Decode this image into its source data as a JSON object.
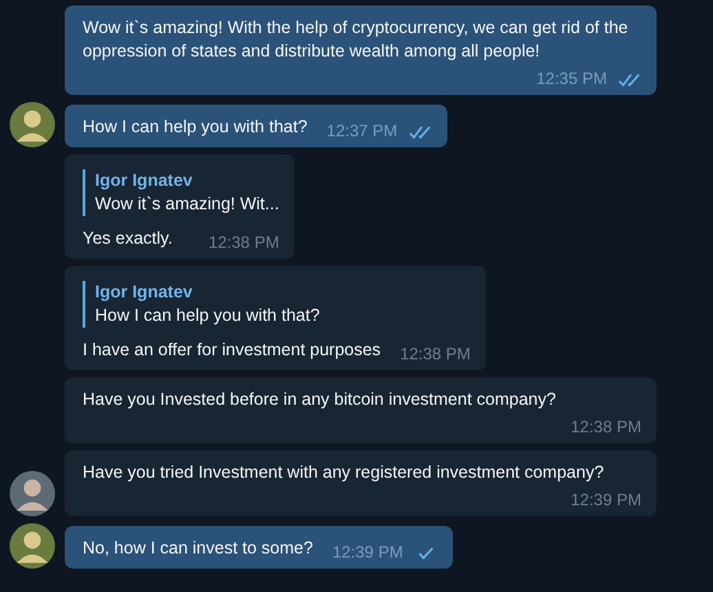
{
  "messages": [
    {
      "outgoing": true,
      "avatar": false,
      "text": "Wow it`s amazing! With the help of cryptocurrency, we can get rid of the oppression of states and distribute wealth among all people!",
      "time": "12:35 PM",
      "read": true
    },
    {
      "outgoing": true,
      "avatar": true,
      "text": "How I can help you with that?",
      "time": "12:37 PM",
      "read": true
    },
    {
      "outgoing": false,
      "avatar": false,
      "reply": {
        "author": "Igor Ignatev",
        "text": "Wow it`s amazing! Wit..."
      },
      "text": "Yes exactly.",
      "time": "12:38 PM"
    },
    {
      "outgoing": false,
      "avatar": false,
      "reply": {
        "author": "Igor Ignatev",
        "text": "How I can help you with that?"
      },
      "text": "I have an offer for investment purposes",
      "time": "12:38 PM"
    },
    {
      "outgoing": false,
      "avatar": false,
      "text": "Have you Invested before in any bitcoin investment company?",
      "time": "12:38 PM"
    },
    {
      "outgoing": false,
      "avatar": true,
      "text": "Have you tried Investment with any registered investment company?",
      "time": "12:39 PM"
    },
    {
      "outgoing": true,
      "avatar": true,
      "text": "No, how I can invest to some?",
      "time": "12:39 PM",
      "read": false
    }
  ]
}
